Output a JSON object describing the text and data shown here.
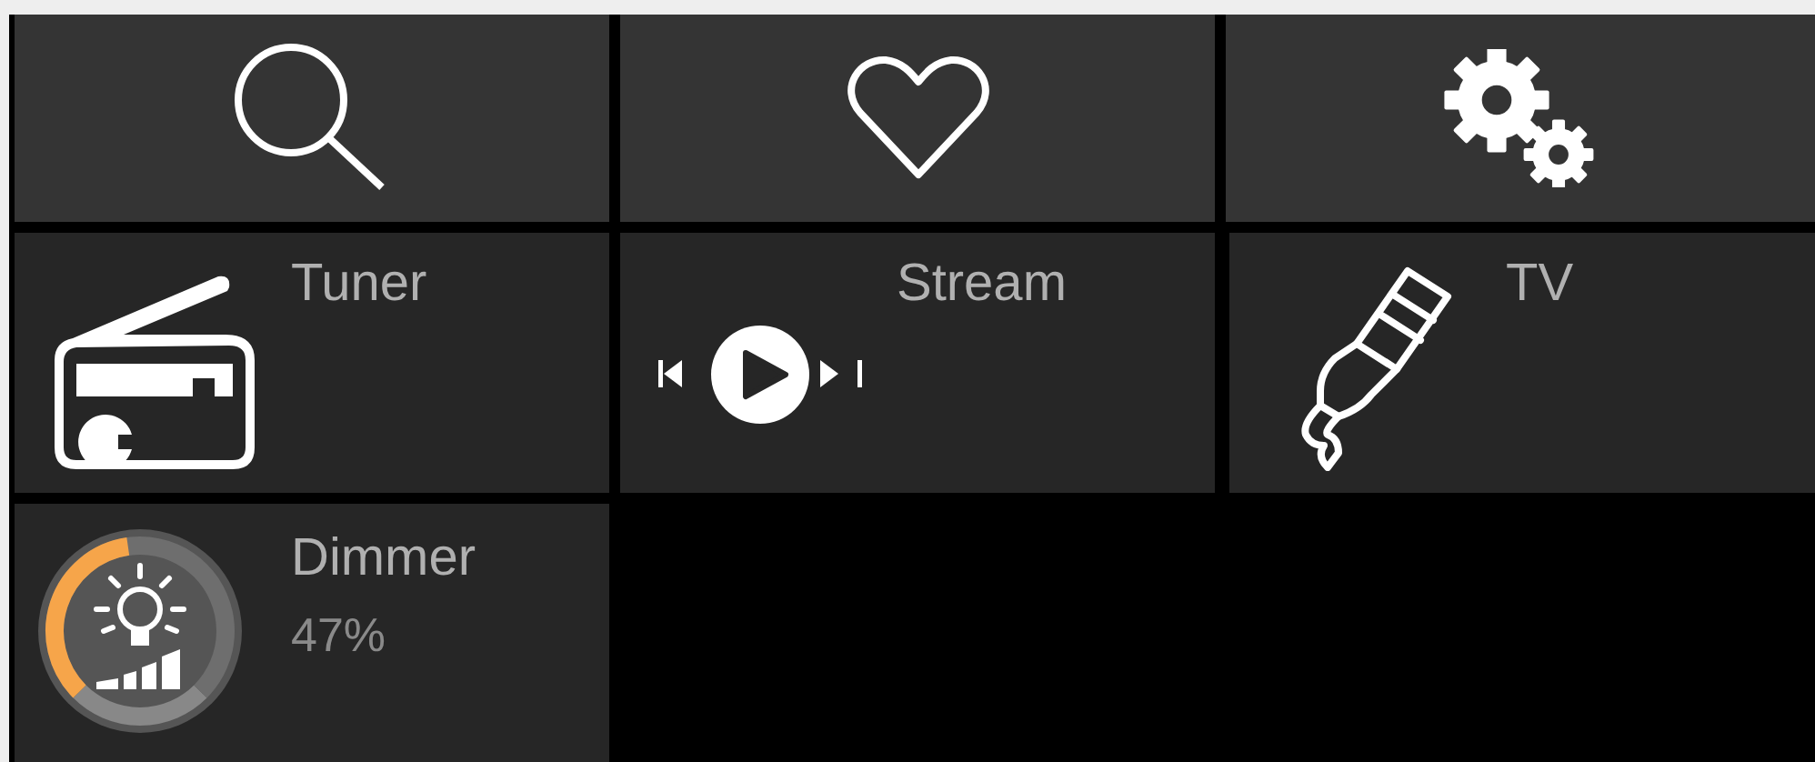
{
  "top_buttons": [
    {
      "kind": "search"
    },
    {
      "kind": "heart"
    },
    {
      "kind": "gears"
    }
  ],
  "sources": [
    {
      "kind": "tuner",
      "label": "Tuner"
    },
    {
      "kind": "stream",
      "label": "Stream"
    },
    {
      "kind": "tv",
      "label": "TV"
    }
  ],
  "dimmer": {
    "label": "Dimmer",
    "value": "47%",
    "level": 0.47
  }
}
